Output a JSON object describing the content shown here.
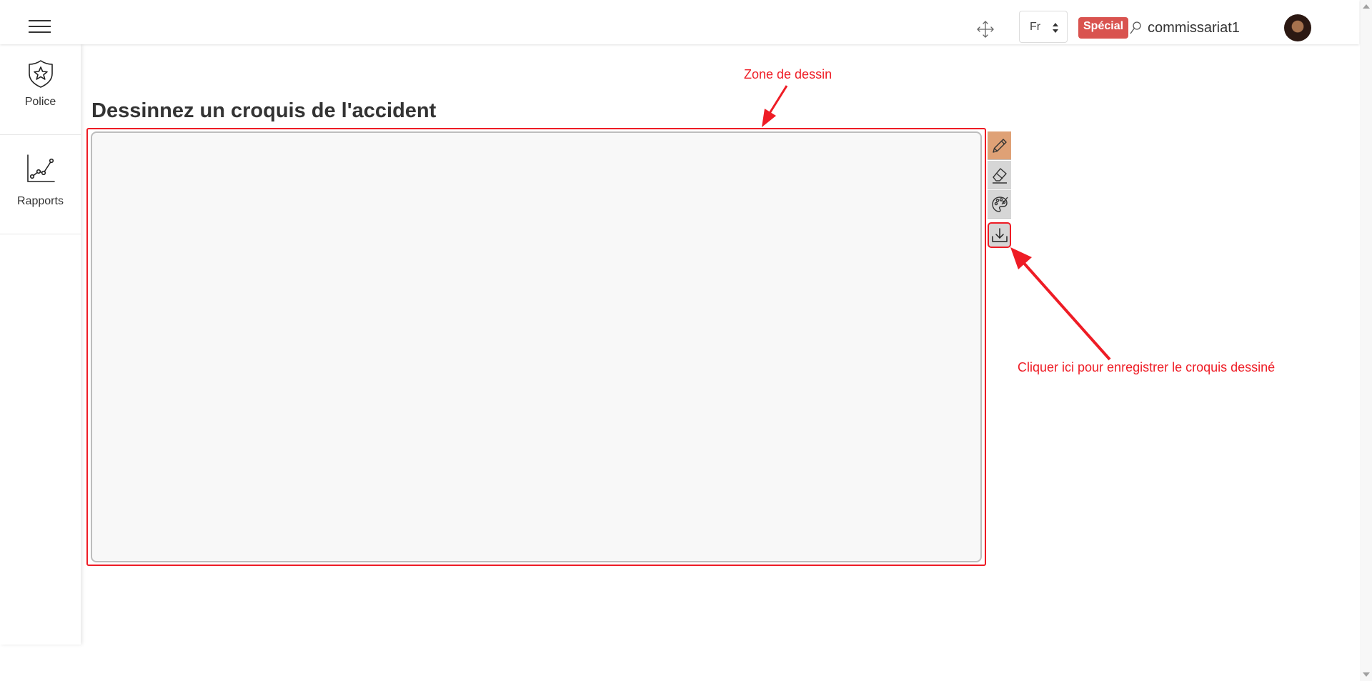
{
  "header": {
    "menu_icon": "hamburger-menu-icon",
    "move_icon": "move-arrows-icon",
    "language": {
      "selected": "Fr"
    },
    "badge": "Spécial",
    "user_icon": "user-icon",
    "username": "commissariat1",
    "avatar_icon": "user-avatar"
  },
  "sidebar": {
    "items": [
      {
        "label": "Police",
        "icon": "shield-star-icon"
      },
      {
        "label": "Rapports",
        "icon": "line-chart-icon"
      }
    ]
  },
  "main": {
    "title": "Dessinnez un croquis de l'accident",
    "tools": [
      {
        "name": "pencil",
        "icon": "pencil-icon",
        "active": true
      },
      {
        "name": "eraser",
        "icon": "eraser-icon"
      },
      {
        "name": "palette",
        "icon": "palette-icon"
      },
      {
        "name": "download",
        "icon": "download-icon"
      }
    ]
  },
  "annotations": {
    "zone_label": "Zone de dessin",
    "save_label": "Cliquer ici pour enregistrer le croquis dessiné",
    "color": "#ee1c25"
  },
  "colors": {
    "active_tool": "#dfa176",
    "tool_bg": "#d6d6d6",
    "badge_bg": "#d9534f",
    "canvas_bg": "#f8f8f8"
  }
}
